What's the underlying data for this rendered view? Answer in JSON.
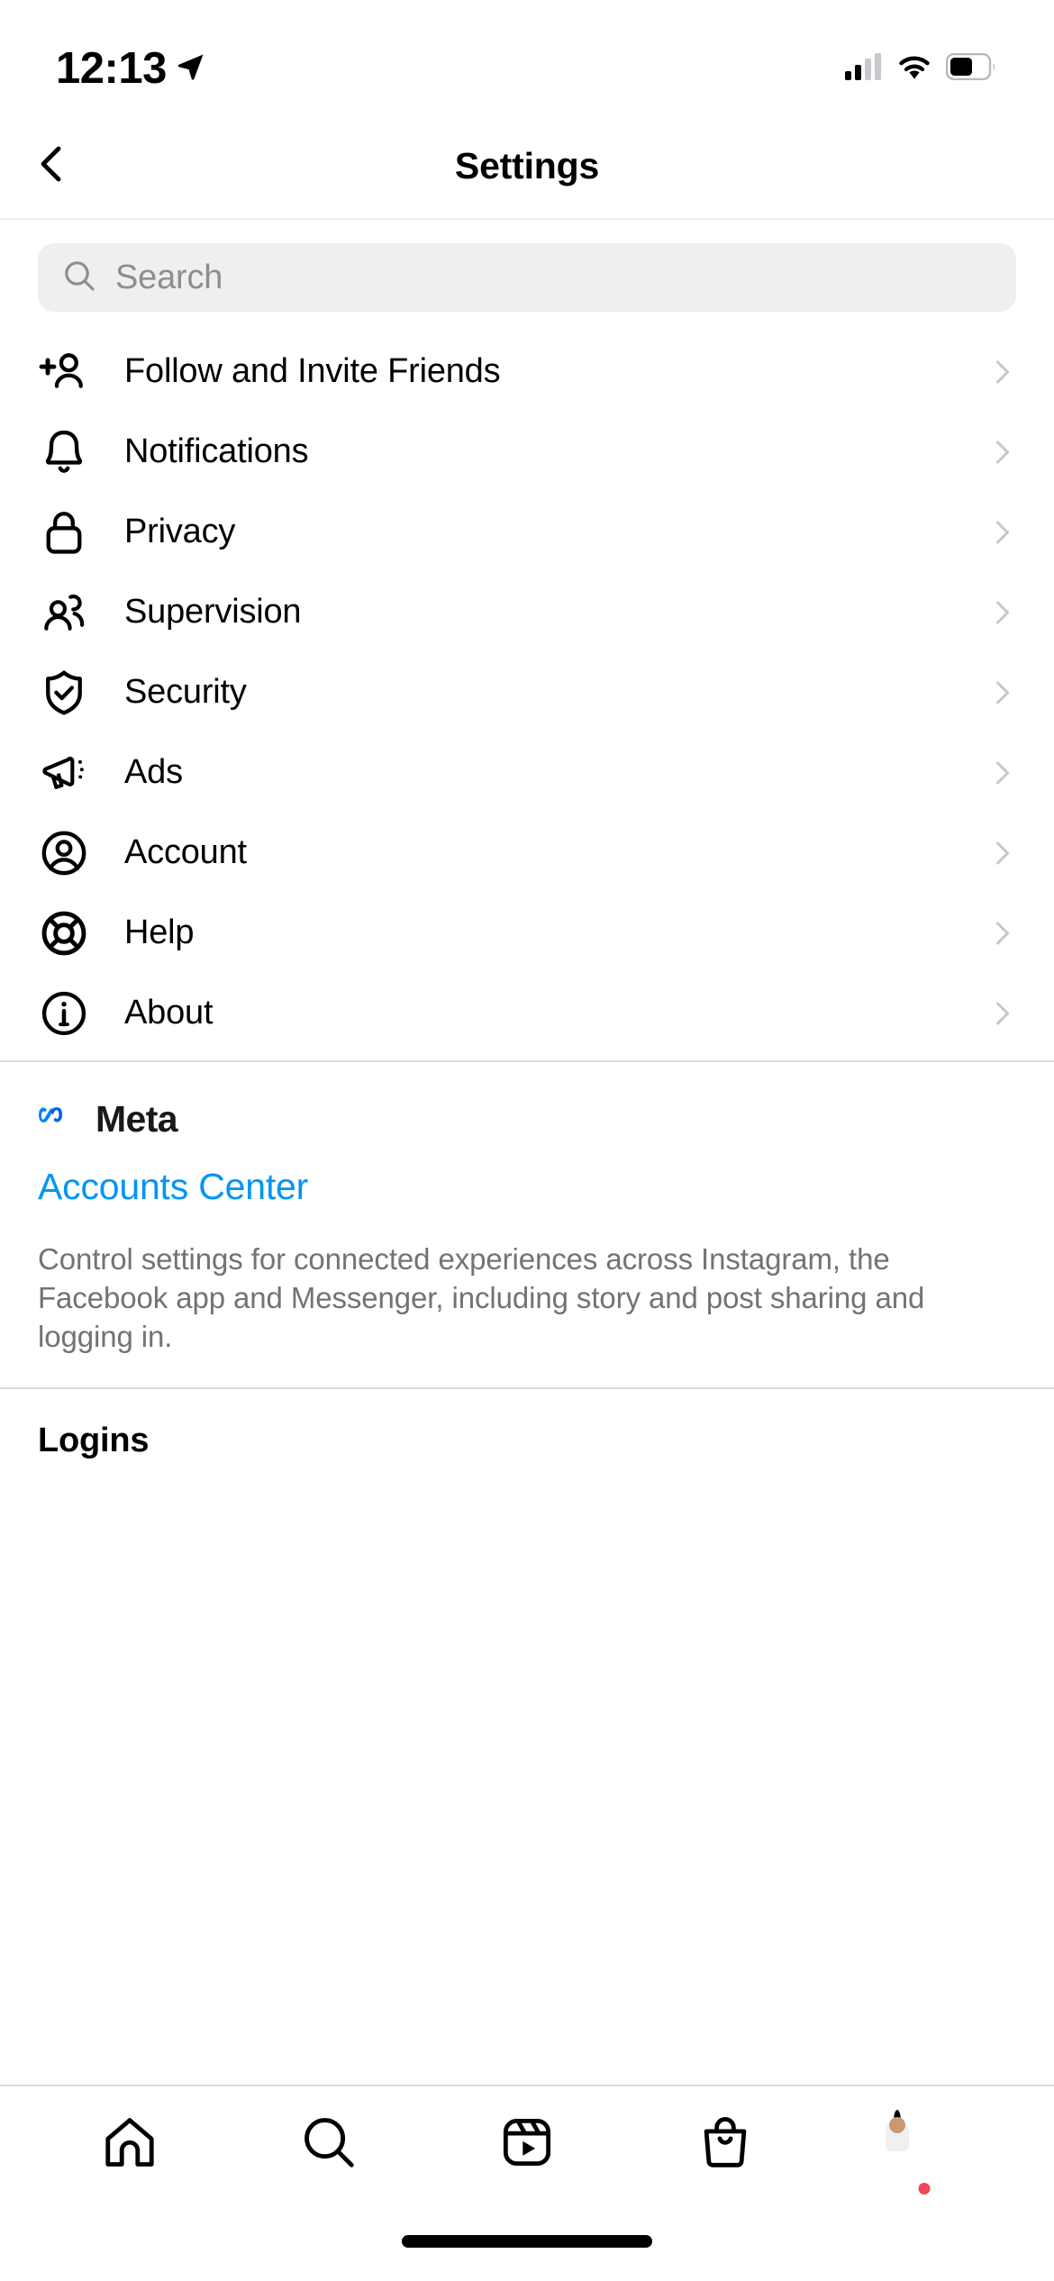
{
  "status_bar": {
    "time": "12:13",
    "location_icon": "location-arrow-icon",
    "cellular_icon": "cellular-bars-icon",
    "wifi_icon": "wifi-icon",
    "battery_icon": "battery-icon"
  },
  "header": {
    "title": "Settings",
    "back_icon": "chevron-left-icon"
  },
  "search": {
    "placeholder": "Search",
    "value": "",
    "icon": "search-icon"
  },
  "menu": {
    "items": [
      {
        "label": "Follow and Invite Friends",
        "icon": "person-add-icon",
        "chevron": "chevron-right-icon"
      },
      {
        "label": "Notifications",
        "icon": "bell-icon",
        "chevron": "chevron-right-icon"
      },
      {
        "label": "Privacy",
        "icon": "lock-icon",
        "chevron": "chevron-right-icon"
      },
      {
        "label": "Supervision",
        "icon": "people-icon",
        "chevron": "chevron-right-icon"
      },
      {
        "label": "Security",
        "icon": "shield-check-icon",
        "chevron": "chevron-right-icon"
      },
      {
        "label": "Ads",
        "icon": "megaphone-icon",
        "chevron": "chevron-right-icon"
      },
      {
        "label": "Account",
        "icon": "account-circle-icon",
        "chevron": "chevron-right-icon"
      },
      {
        "label": "Help",
        "icon": "lifebuoy-icon",
        "chevron": "chevron-right-icon"
      },
      {
        "label": "About",
        "icon": "info-circle-icon",
        "chevron": "chevron-right-icon"
      }
    ]
  },
  "meta_section": {
    "brand_icon": "meta-infinity-logo-icon",
    "brand_name": "Meta",
    "link_label": "Accounts Center",
    "description": "Control settings for connected experiences across Instagram, the Facebook app and Messenger, including story and post sharing and logging in.",
    "link_color": "#0095f6",
    "brand_logo_color": "#0081fb"
  },
  "logins_section": {
    "title": "Logins"
  },
  "tab_bar": {
    "items": [
      {
        "name": "home",
        "icon": "home-icon"
      },
      {
        "name": "search",
        "icon": "search-icon"
      },
      {
        "name": "reels",
        "icon": "reels-play-icon"
      },
      {
        "name": "shop",
        "icon": "shopping-bag-icon"
      },
      {
        "name": "profile",
        "icon": "profile-avatar-icon"
      }
    ],
    "profile_badge_color": "#ed4956"
  }
}
